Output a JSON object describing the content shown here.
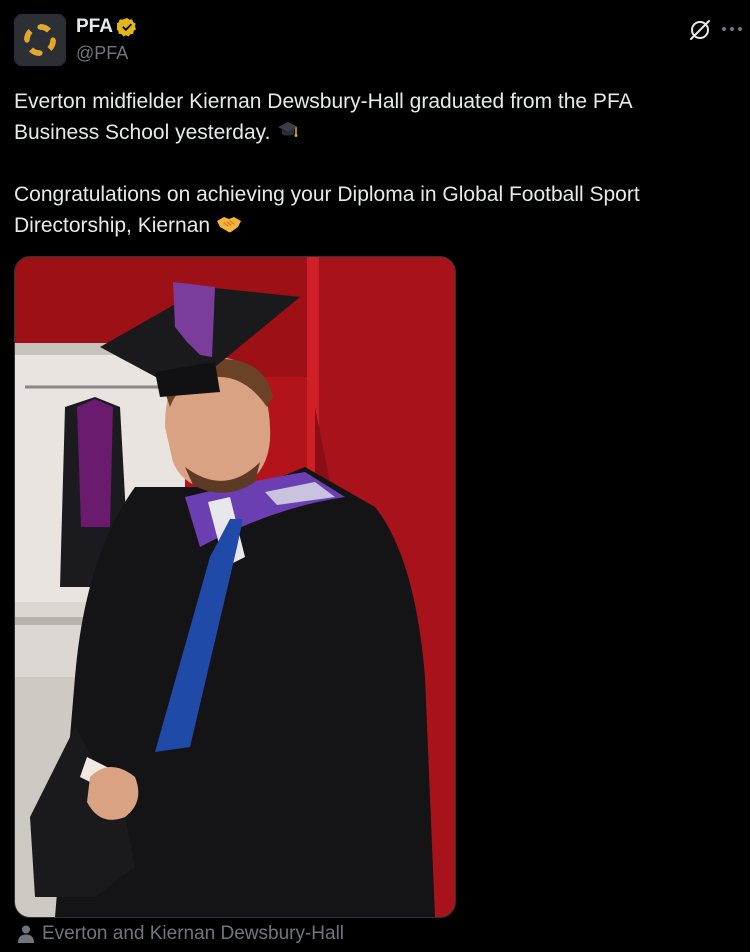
{
  "author": {
    "display_name": "PFA",
    "handle": "@PFA",
    "verified": true,
    "verified_color": "#e2b719",
    "avatar_icon": "pfa-logo-icon"
  },
  "actions": {
    "grok_icon": "grok-icon",
    "more_icon": "more-options-icon"
  },
  "tweet": {
    "paragraph1": "Everton midfielder Kiernan Dewsbury-Hall graduated from the PFA Business School yesterday.",
    "paragraph1_emoji": "graduation-cap-icon",
    "paragraph2": "Congratulations on achieving your Diploma in Global Football Sport Directorship, Kiernan",
    "paragraph2_emoji": "handshake-icon"
  },
  "media": {
    "description_icon": "photo"
  },
  "tagged": {
    "icon": "person-icon",
    "text": "Everton and Kiernan Dewsbury-Hall"
  },
  "colors": {
    "background": "#000000",
    "text": "#e7e9ea",
    "secondary": "#71767b",
    "photo_red": "#c4161c"
  }
}
